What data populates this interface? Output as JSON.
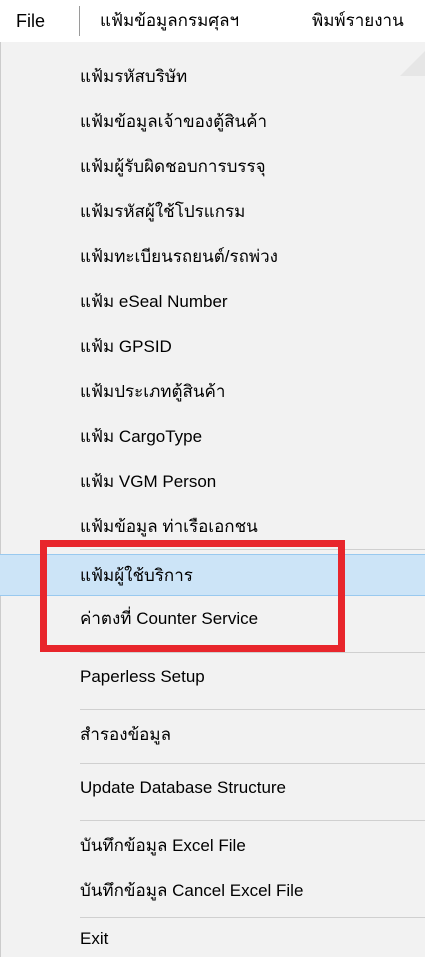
{
  "menubar": {
    "file": "File",
    "item2": "แฟ้มข้อมูลกรมศุลฯ",
    "item3": "พิมพ์รายงาน"
  },
  "menu": {
    "items": [
      "แฟ้มรหัสบริษัท",
      "แฟ้มข้อมูลเจ้าของตู้สินค้า",
      "แฟ้มผู้รับผิดชอบการบรรจุ",
      "แฟ้มรหัสผู้ใช้โปรแกรม",
      "แฟ้มทะเบียนรถยนต์/รถพ่วง",
      "แฟ้ม eSeal Number",
      "แฟ้ม GPSID",
      "แฟ้มประเภทตู้สินค้า",
      "แฟ้ม CargoType",
      "แฟ้ม VGM Person",
      "แฟ้มข้อมูล ท่าเรือเอกชน",
      "แฟ้มผู้ใช้บริการ",
      "ค่าตงที่ Counter Service",
      "Paperless Setup",
      "สำรองข้อมูล",
      "Update Database Structure",
      "บันทึกข้อมูล Excel File",
      "บันทึกข้อมูล Cancel Excel File",
      "Exit"
    ]
  },
  "highlighted_item": "แฟ้มผู้ใช้บริการ",
  "colors": {
    "highlight": "#cce4f7",
    "annotation": "#e8262c",
    "menu_background": "#f2f2f2"
  }
}
